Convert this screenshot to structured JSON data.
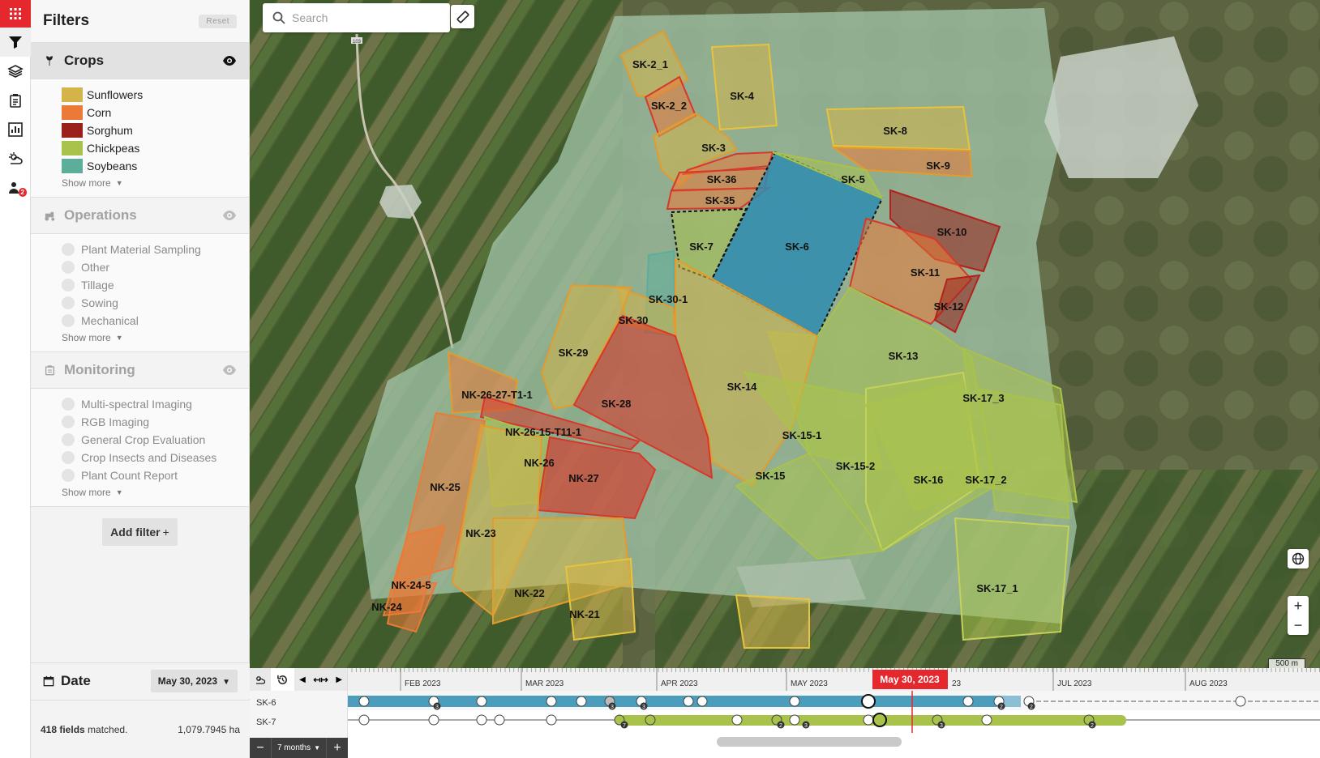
{
  "panel": {
    "title": "Filters",
    "reset_label": "Reset",
    "crops": {
      "label": "Crops",
      "items": [
        {
          "label": "Sunflowers",
          "color": "#d4b449"
        },
        {
          "label": "Corn",
          "color": "#ec7a37"
        },
        {
          "label": "Sorghum",
          "color": "#99211a"
        },
        {
          "label": "Chickpeas",
          "color": "#a9c24c"
        },
        {
          "label": "Soybeans",
          "color": "#5cae9a"
        }
      ],
      "show_more": "Show more"
    },
    "operations": {
      "label": "Operations",
      "items": [
        "Plant Material Sampling",
        "Other",
        "Tillage",
        "Sowing",
        "Mechanical"
      ],
      "show_more": "Show more"
    },
    "monitoring": {
      "label": "Monitoring",
      "items": [
        "Multi-spectral Imaging",
        "RGB Imaging",
        "General Crop Evaluation",
        "Crop Insects and Diseases",
        "Plant Count Report"
      ],
      "show_more": "Show more"
    },
    "add_filter": "Add filter",
    "date_label": "Date",
    "date_value": "May 30, 2023",
    "matched_count": "418 fields",
    "matched_suffix": "matched.",
    "matched_area": "1,079.7945 ha"
  },
  "map": {
    "search_placeholder": "Search",
    "scale_label": "500 m",
    "road_label": "103",
    "fields": [
      {
        "label": "SK-2_1"
      },
      {
        "label": "SK-2_2"
      },
      {
        "label": "SK-4"
      },
      {
        "label": "SK-3"
      },
      {
        "label": "SK-8"
      },
      {
        "label": "SK-9"
      },
      {
        "label": "SK-36"
      },
      {
        "label": "SK-5"
      },
      {
        "label": "SK-35"
      },
      {
        "label": "SK-7"
      },
      {
        "label": "SK-6"
      },
      {
        "label": "SK-10"
      },
      {
        "label": "SK-11"
      },
      {
        "label": "SK-12"
      },
      {
        "label": "SK-30-1"
      },
      {
        "label": "SK-30"
      },
      {
        "label": "SK-29"
      },
      {
        "label": "SK-13"
      },
      {
        "label": "SK-14"
      },
      {
        "label": "SK-28"
      },
      {
        "label": "NK-26-27-T1-1"
      },
      {
        "label": "SK-17_3"
      },
      {
        "label": "NK-26-15-T11-1"
      },
      {
        "label": "SK-15-1"
      },
      {
        "label": "NK-26"
      },
      {
        "label": "SK-15-2"
      },
      {
        "label": "SK-15"
      },
      {
        "label": "NK-27"
      },
      {
        "label": "SK-16"
      },
      {
        "label": "SK-17_2"
      },
      {
        "label": "NK-25"
      },
      {
        "label": "NK-23"
      },
      {
        "label": "NK-24-5"
      },
      {
        "label": "NK-22"
      },
      {
        "label": "SK-17_1"
      },
      {
        "label": "NK-24"
      },
      {
        "label": "NK-21"
      }
    ]
  },
  "timeline": {
    "months": [
      "FEB 2023",
      "MAR 2023",
      "APR 2023",
      "MAY 2023",
      "JUL 2023",
      "AUG 2023"
    ],
    "current_date": "May 30, 2023",
    "current_date_overflow": "23",
    "rows": [
      {
        "label": "SK-6",
        "color": "#4b9dbb",
        "badges": [
          "3",
          "3",
          "3",
          "2",
          "2"
        ]
      },
      {
        "label": "SK-7",
        "color": "#a9c24c",
        "badges": [
          "7",
          "2",
          "3",
          "3",
          "2"
        ]
      }
    ],
    "zoom_label": "7 months"
  }
}
